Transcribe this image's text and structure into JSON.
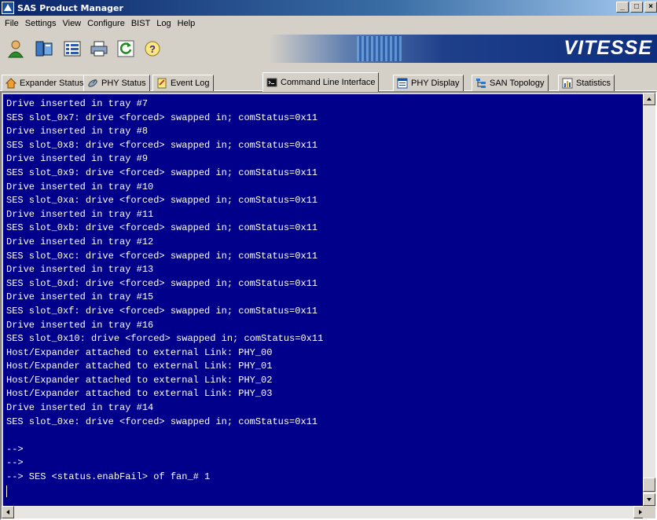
{
  "window": {
    "title": "SAS Product Manager",
    "controls": {
      "minimize": "_",
      "maximize": "□",
      "close": "×"
    }
  },
  "menu": [
    "File",
    "Settings",
    "View",
    "Configure",
    "BIST",
    "Log",
    "Help"
  ],
  "toolbar": {
    "icons": [
      "user-icon",
      "device-icon",
      "list-icon",
      "printer-icon",
      "refresh-icon",
      "help-icon"
    ]
  },
  "banner": {
    "brand": "VITESSE"
  },
  "tabs": [
    {
      "label": "Expander Status",
      "icon": "home-icon"
    },
    {
      "label": "PHY Status",
      "icon": "satellite-icon"
    },
    {
      "label": "Event Log",
      "icon": "notepad-icon"
    },
    {
      "label": "Command Line Interface",
      "icon": "terminal-icon",
      "active": true
    },
    {
      "label": "PHY Display",
      "icon": "window-icon"
    },
    {
      "label": "SAN Topology",
      "icon": "tree-icon"
    },
    {
      "label": "Statistics",
      "icon": "chart-icon"
    }
  ],
  "console": {
    "lines": [
      "Drive inserted in tray #7",
      "SES slot_0x7: drive <forced> swapped in; comStatus=0x11",
      "Drive inserted in tray #8",
      "SES slot_0x8: drive <forced> swapped in; comStatus=0x11",
      "Drive inserted in tray #9",
      "SES slot_0x9: drive <forced> swapped in; comStatus=0x11",
      "Drive inserted in tray #10",
      "SES slot_0xa: drive <forced> swapped in; comStatus=0x11",
      "Drive inserted in tray #11",
      "SES slot_0xb: drive <forced> swapped in; comStatus=0x11",
      "Drive inserted in tray #12",
      "SES slot_0xc: drive <forced> swapped in; comStatus=0x11",
      "Drive inserted in tray #13",
      "SES slot_0xd: drive <forced> swapped in; comStatus=0x11",
      "Drive inserted in tray #15",
      "SES slot_0xf: drive <forced> swapped in; comStatus=0x11",
      "Drive inserted in tray #16",
      "SES slot_0x10: drive <forced> swapped in; comStatus=0x11",
      "Host/Expander attached to external Link: PHY_00",
      "Host/Expander attached to external Link: PHY_01",
      "Host/Expander attached to external Link: PHY_02",
      "Host/Expander attached to external Link: PHY_03",
      "Drive inserted in tray #14",
      "SES slot_0xe: drive <forced> swapped in; comStatus=0x11",
      "",
      "-->",
      "-->",
      "--> SES <status.enabFail> of fan_# 1",
      ""
    ],
    "background": "#00008b",
    "foreground": "#ffffff"
  }
}
